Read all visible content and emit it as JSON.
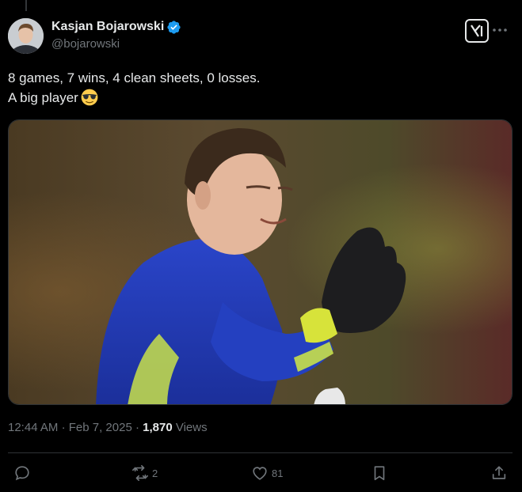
{
  "author": {
    "display_name": "Kasjan Bojarowski",
    "handle": "@bojarowski",
    "verified": true
  },
  "tweet": {
    "line1": "8 games, 7 wins, 4 clean sheets, 0 losses.",
    "line2": "A big player",
    "emoji": "smiling-face-with-sunglasses"
  },
  "meta": {
    "time": "12:44 AM",
    "separator": "·",
    "date": "Feb 7, 2025",
    "views_count": "1,870",
    "views_label": "Views"
  },
  "actions": {
    "replies": "",
    "reposts": "2",
    "likes": "81"
  },
  "colors": {
    "background": "#000000",
    "text": "#e7e9ea",
    "secondary": "#71767b",
    "verified": "#1d9bf0",
    "divider": "#2f3336"
  }
}
